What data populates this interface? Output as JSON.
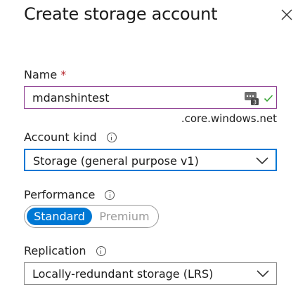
{
  "blade": {
    "title": "Create storage account"
  },
  "name_field": {
    "label": "Name",
    "required_marker": "*",
    "value": "mdanshintest",
    "suffix": ".core.windows.net",
    "status": "valid"
  },
  "account_kind": {
    "label": "Account kind",
    "selected": "Storage (general purpose v1)"
  },
  "performance": {
    "label": "Performance",
    "options": [
      "Standard",
      "Premium"
    ],
    "selected": "Standard"
  },
  "replication": {
    "label": "Replication",
    "selected": "Locally-redundant storage (LRS)"
  },
  "colors": {
    "accent": "#0078d4",
    "input_focus_border": "#8b3a8f",
    "valid_check": "#3aa537",
    "required": "#b4232a"
  },
  "icons": [
    "close-icon",
    "info-icon",
    "password-manager-icon",
    "checkmark-icon",
    "chevron-down-icon"
  ]
}
